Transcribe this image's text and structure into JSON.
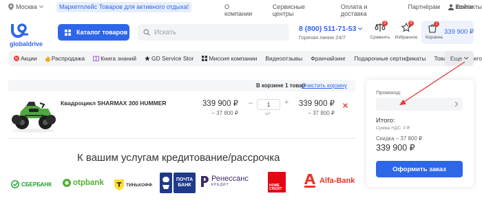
{
  "topbar": {
    "city": "Москва",
    "promo": "Маркетплейс Товаров для активного отдыха!",
    "links": [
      "О компании",
      "Сервисные центры",
      "Оплата и доставка",
      "Партнёрам",
      "Контакты"
    ],
    "login": "Войти"
  },
  "header": {
    "logo": "globaldrive",
    "catalog_button": "Каталог товаров",
    "search_placeholder": "Искать",
    "phone": "8 (800) 511-71-53",
    "phone_note": "Горячая линия 24/7",
    "compare_label": "Сравнить",
    "compare_count": "0",
    "favorites_label": "Избранное",
    "favorites_count": "0",
    "cart_label": "Корзина",
    "cart_count": "1",
    "cart_total": "339 900 ₽"
  },
  "nav": {
    "items": [
      "Акции",
      "Распродажа",
      "Книга знаний",
      "GD Service Stor",
      "Миссия компании",
      "Видеоотзывы",
      "Франчайзинг",
      "Подарочные сертификаты",
      "Товары с пробегом"
    ],
    "more": "Еще"
  },
  "cart": {
    "summary": "В корзине 1 товар",
    "clear": "Очистить корзину",
    "item": {
      "name": "Квадроцикл SHARMAX 300 HUMMER",
      "price": "339 900 ₽",
      "price_discount": "– 37 800 ₽",
      "quantity": "1",
      "unit": "шт",
      "total": "339 900 ₽",
      "total_discount": "– 37 800 ₽"
    }
  },
  "credit": {
    "title": "К вашим услугам кредитование/рассрочка",
    "banks": [
      "СБЕРБАНК",
      "otpbank",
      "ТИНЬКОФФ",
      "ПОЧТА БАНК",
      "Ренессанс",
      "КРЕДИТ",
      "HOME CREDIT",
      "Alfa-Bank"
    ]
  },
  "order_panel": {
    "promo_label": "Промокод:",
    "total_label": "Итого:",
    "vat_note": "Сумма НДС: 0 ₽",
    "discount_text": "Скидка – 37 800 ₽",
    "total": "339 900 ₽",
    "submit": "Оформить заказ"
  },
  "colors": {
    "accent": "#2e66e8",
    "remove": "#e53935",
    "sber": "#1a9f29",
    "otp": "#52ae30",
    "pochta": "#1e3a8a",
    "renessans": "#3d2b6b",
    "home_credit": "#e30613",
    "alfa": "#ef3124"
  }
}
